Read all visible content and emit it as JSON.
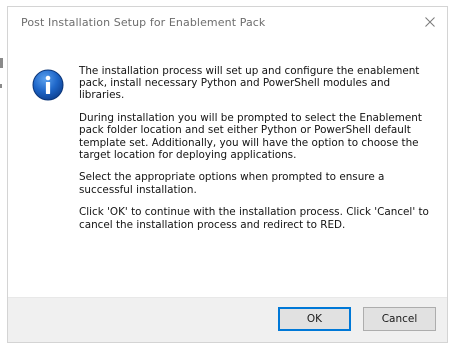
{
  "window": {
    "title": "Post Installation Setup for Enablement Pack"
  },
  "icons": {
    "dialog_icon": "info-icon",
    "close": "close-icon",
    "info_color": "#1e66c8"
  },
  "message": {
    "paragraphs": [
      "The installation process will set up and configure the enablement pack, install necessary Python and PowerShell modules and libraries.",
      "During installation you will be prompted to select the Enablement pack folder location and set either Python or PowerShell default template set. Additionally, you will have the option to choose the target location for deploying applications.",
      "Select the appropriate options when prompted to ensure a successful installation.",
      "Click 'OK' to continue with the installation process. Click 'Cancel' to cancel the installation process and redirect to RED."
    ]
  },
  "buttons": {
    "ok_label": "OK",
    "cancel_label": "Cancel"
  }
}
